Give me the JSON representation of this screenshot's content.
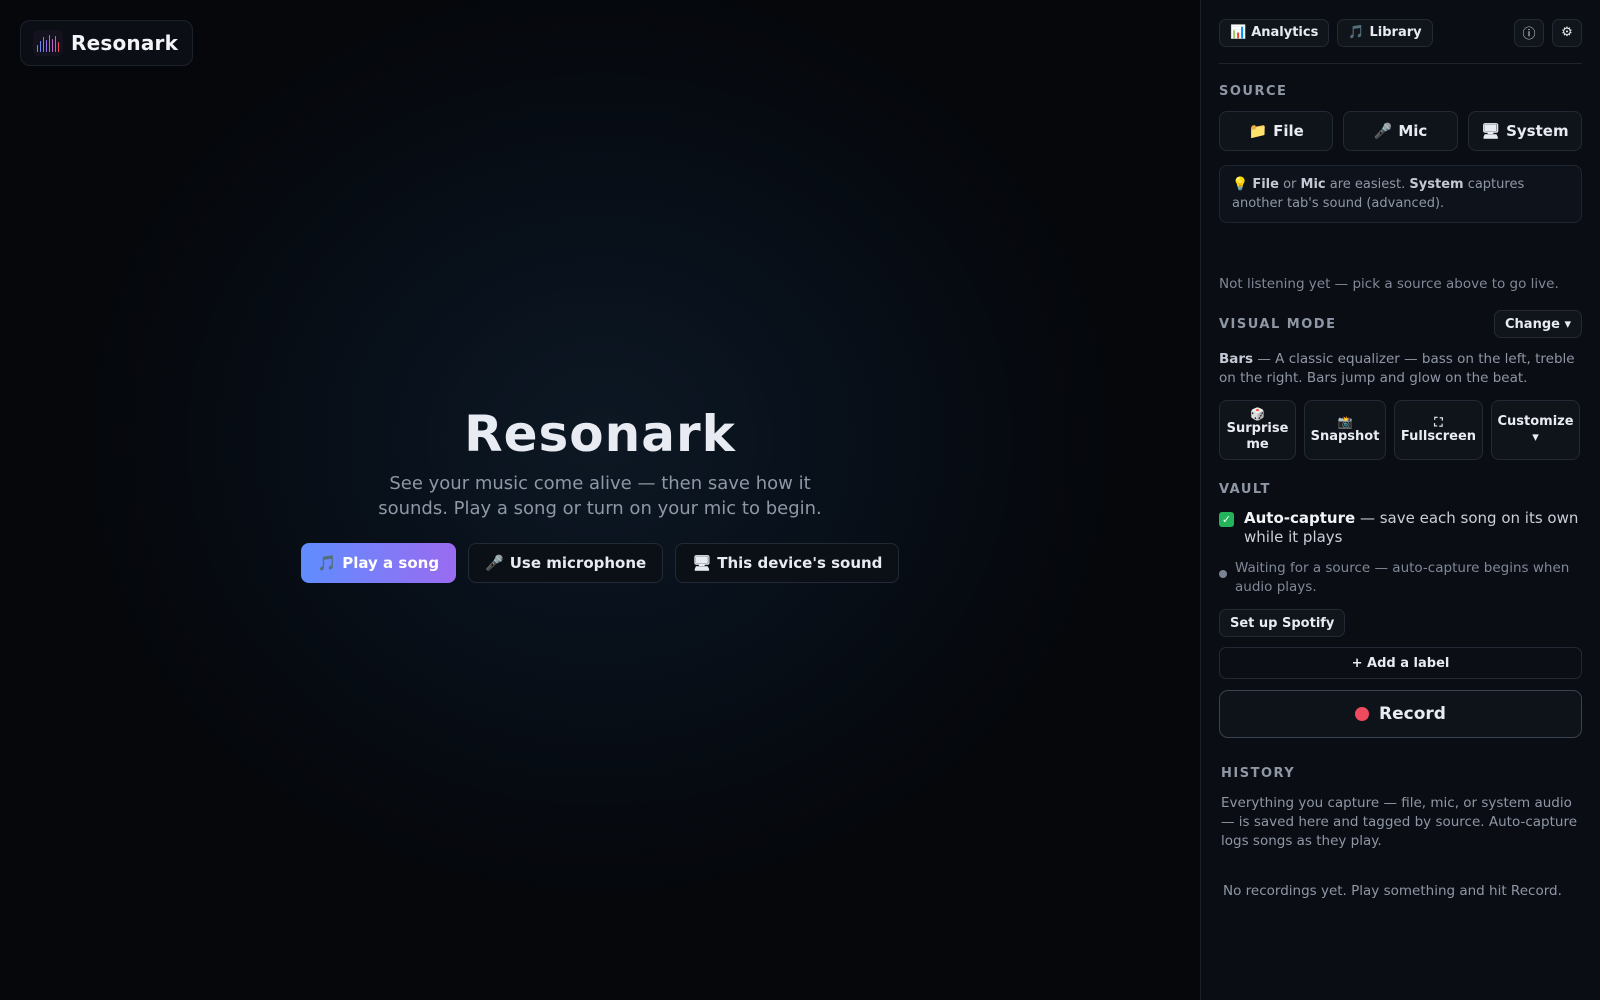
{
  "app": {
    "name": "Resonark"
  },
  "hero": {
    "title": "Resonark",
    "subtitle": "See your music come alive — then save how it sounds. Play a song or turn on your mic to begin.",
    "buttons": [
      {
        "icon": "🎵",
        "label": "Play a song"
      },
      {
        "icon": "🎤",
        "label": "Use microphone"
      },
      {
        "icon": "🖥",
        "label": "This device's sound"
      }
    ]
  },
  "topbar": {
    "analytics": {
      "icon": "📊",
      "label": "Analytics"
    },
    "library": {
      "icon": "🎵",
      "label": "Library"
    },
    "info_icon": "ⓘ",
    "settings_icon": "⚙"
  },
  "source": {
    "heading": "SOURCE",
    "buttons": [
      {
        "icon": "📁",
        "label": "File"
      },
      {
        "icon": "🎤",
        "label": "Mic"
      },
      {
        "icon": "🖥",
        "label": "System"
      }
    ],
    "hint": {
      "icon": "💡",
      "file": "File",
      "or": " or ",
      "mic": "Mic",
      "easiest": " are easiest. ",
      "system": "System",
      "rest": " captures another tab's sound (advanced)."
    },
    "status": "Not listening yet — pick a source above to go live."
  },
  "visual_mode": {
    "heading": "VISUAL MODE",
    "change_label": "Change ▾",
    "mode_name": "Bars",
    "mode_desc": " — A classic equalizer — bass on the left, treble on the right. Bars jump and glow on the beat.",
    "tools": [
      {
        "icon": "🎲",
        "label": "Surprise me"
      },
      {
        "icon": "📸",
        "label": "Snapshot"
      },
      {
        "icon": "⛶",
        "label": "Fullscreen"
      },
      {
        "icon": "",
        "label": "Customize ▾"
      }
    ]
  },
  "vault": {
    "heading": "VAULT",
    "auto_capture_title": "Auto-capture",
    "auto_capture_desc": " — save each song on its own while it plays",
    "auto_capture_checked": true,
    "waiting": "Waiting for a source — auto-capture begins when audio plays.",
    "spotify_label": "Set up Spotify",
    "add_label": "+ Add a label",
    "record_label": "Record"
  },
  "history": {
    "heading": "HISTORY",
    "desc": "Everything you capture — file, mic, or system audio — is saved here and tagged by source. Auto-capture logs songs as they play.",
    "empty": "No recordings yet. Play something and hit Record."
  },
  "colors": {
    "accent_start": "#5f8dff",
    "accent_end": "#9a6bf0",
    "record": "#f04a5e",
    "check": "#22b35b"
  }
}
